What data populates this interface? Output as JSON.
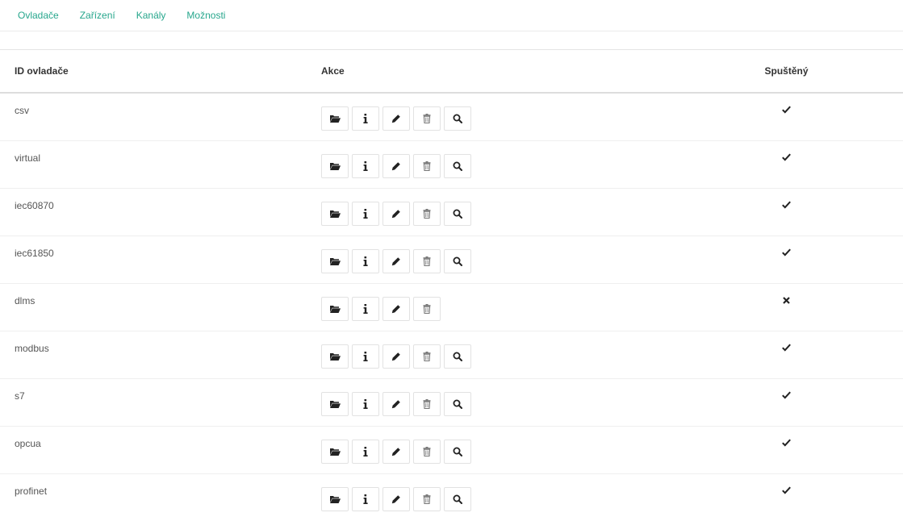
{
  "nav": {
    "items": [
      "Ovladače",
      "Zařízení",
      "Kanály",
      "Možnosti"
    ]
  },
  "table": {
    "headers": {
      "id": "ID ovladače",
      "actions": "Akce",
      "running": "Spuštěný"
    },
    "rows": [
      {
        "id": "csv",
        "running": true,
        "actions": [
          "folder-icon",
          "info-icon",
          "pencil-icon",
          "trash-icon",
          "search-icon"
        ]
      },
      {
        "id": "virtual",
        "running": true,
        "actions": [
          "folder-icon",
          "info-icon",
          "pencil-icon",
          "trash-icon",
          "search-icon"
        ]
      },
      {
        "id": "iec60870",
        "running": true,
        "actions": [
          "folder-icon",
          "info-icon",
          "pencil-icon",
          "trash-icon",
          "search-icon"
        ]
      },
      {
        "id": "iec61850",
        "running": true,
        "actions": [
          "folder-icon",
          "info-icon",
          "pencil-icon",
          "trash-icon",
          "search-icon"
        ]
      },
      {
        "id": "dlms",
        "running": false,
        "actions": [
          "folder-icon",
          "info-icon",
          "pencil-icon",
          "trash-icon"
        ]
      },
      {
        "id": "modbus",
        "running": true,
        "actions": [
          "folder-icon",
          "info-icon",
          "pencil-icon",
          "trash-icon",
          "search-icon"
        ]
      },
      {
        "id": "s7",
        "running": true,
        "actions": [
          "folder-icon",
          "info-icon",
          "pencil-icon",
          "trash-icon",
          "search-icon"
        ]
      },
      {
        "id": "opcua",
        "running": true,
        "actions": [
          "folder-icon",
          "info-icon",
          "pencil-icon",
          "trash-icon",
          "search-icon"
        ]
      },
      {
        "id": "profinet",
        "running": true,
        "actions": [
          "folder-icon",
          "info-icon",
          "pencil-icon",
          "trash-icon",
          "search-icon"
        ]
      }
    ]
  },
  "colors": {
    "nav_link": "#26a68c",
    "text": "#333333",
    "border": "#e2e2e2"
  }
}
